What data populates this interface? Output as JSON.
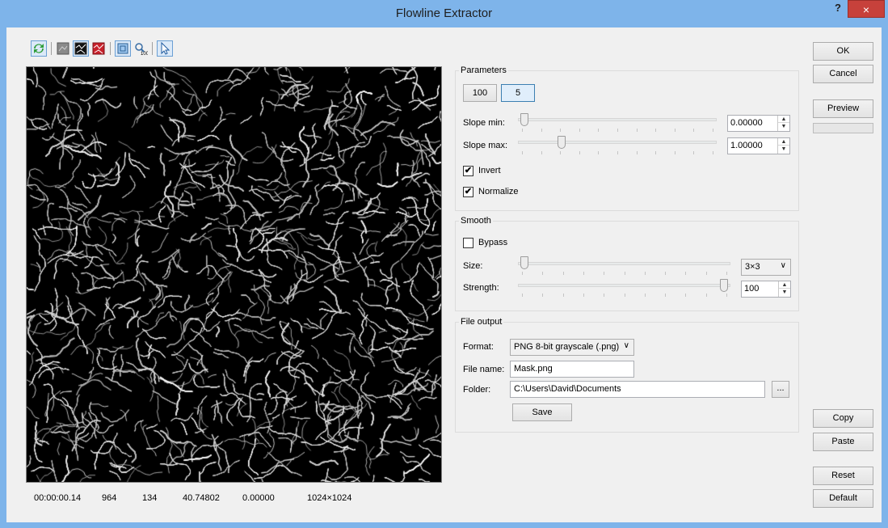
{
  "window": {
    "title": "Flowline Extractor",
    "help_label": "?",
    "close_label": "×"
  },
  "toolbar": {
    "icons": [
      "refresh-icon",
      "grayscale-image-icon",
      "mask-image-icon",
      "red-mask-icon",
      "fit-view-icon",
      "zoom-100-icon",
      "pointer-icon"
    ]
  },
  "status": {
    "time": "00:00:00.14",
    "x": "964",
    "y": "134",
    "value": "40.74802",
    "slope": "0.00000",
    "resolution": "1024×1024"
  },
  "parameters": {
    "label": "Parameters",
    "mode_buttons": [
      "100",
      "5"
    ],
    "slope_min": {
      "label": "Slope min:",
      "value": "0.00000",
      "level": 0.0
    },
    "slope_max": {
      "label": "Slope max:",
      "value": "1.00000",
      "level": 0.2
    },
    "invert": {
      "label": "Invert",
      "checked": true
    },
    "normalize": {
      "label": "Normalize",
      "checked": true
    }
  },
  "smooth": {
    "label": "Smooth",
    "bypass": {
      "label": "Bypass",
      "checked": false
    },
    "size": {
      "label": "Size:",
      "value": "3×3",
      "level": 0.0
    },
    "strength": {
      "label": "Strength:",
      "value": "100",
      "level": 1.0
    }
  },
  "file_output": {
    "label": "File output",
    "format": {
      "label": "Format:",
      "value": "PNG 8-bit grayscale (.png)"
    },
    "file_name": {
      "label": "File name:",
      "value": "Mask.png"
    },
    "folder": {
      "label": "Folder:",
      "value": "C:\\Users\\David\\Documents",
      "browse_label": "..."
    },
    "save_label": "Save"
  },
  "side_buttons": {
    "ok": "OK",
    "cancel": "Cancel",
    "preview": "Preview",
    "copy": "Copy",
    "paste": "Paste",
    "reset": "Reset",
    "default": "Default"
  },
  "check_glyph": "✔"
}
